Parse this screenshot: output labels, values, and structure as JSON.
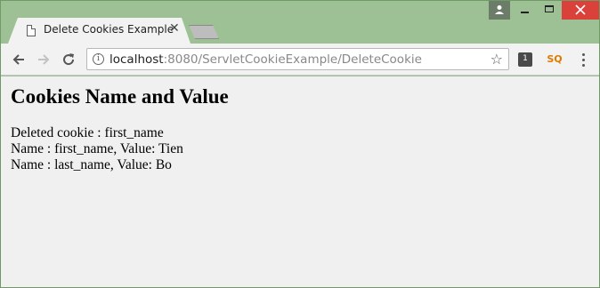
{
  "browser": {
    "tab": {
      "title": "Delete Cookies Example",
      "close_icon": "close-icon",
      "favicon": "document-icon"
    },
    "address": {
      "host": "localhost",
      "rest": ":8080/ServletCookieExample/DeleteCookie"
    },
    "extension_badge": "1",
    "extension2": "SQ"
  },
  "page": {
    "heading": "Cookies Name and Value",
    "lines": [
      "Deleted cookie : first_name",
      "Name : first_name, Value: Tien",
      "Name : last_name, Value: Bo"
    ]
  }
}
